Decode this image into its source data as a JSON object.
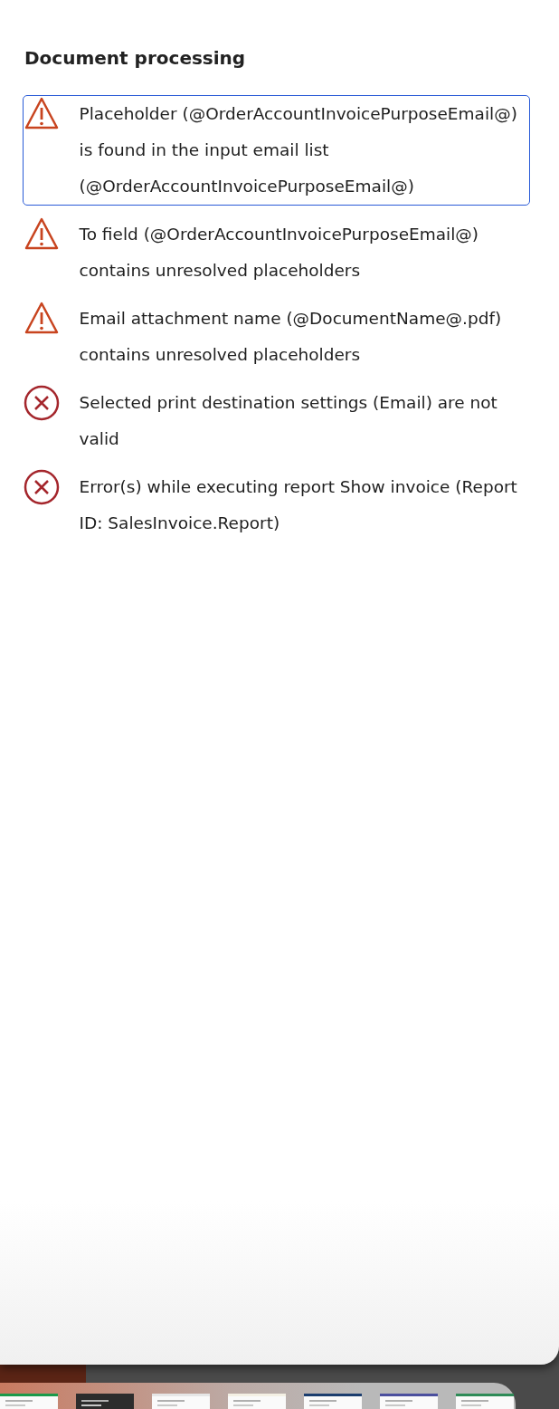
{
  "section_title": "Document processing",
  "messages": [
    {
      "kind": "warning",
      "selected": true,
      "text": "Placeholder (@OrderAccountInvoicePurposeEmail@) is found in the input email list (@OrderAccountInvoicePurposeEmail@)"
    },
    {
      "kind": "warning",
      "selected": false,
      "text": "To field (@OrderAccountInvoicePurposeEmail@) contains unresolved placeholders"
    },
    {
      "kind": "warning",
      "selected": false,
      "text": "Email attachment name (@DocumentName@.pdf) contains unresolved placeholders"
    },
    {
      "kind": "error",
      "selected": false,
      "text": "Selected print destination settings (Email) are not valid"
    },
    {
      "kind": "error",
      "selected": false,
      "text": "Error(s) while executing report Show invoice (Report ID: SalesInvoice.Report)"
    }
  ]
}
